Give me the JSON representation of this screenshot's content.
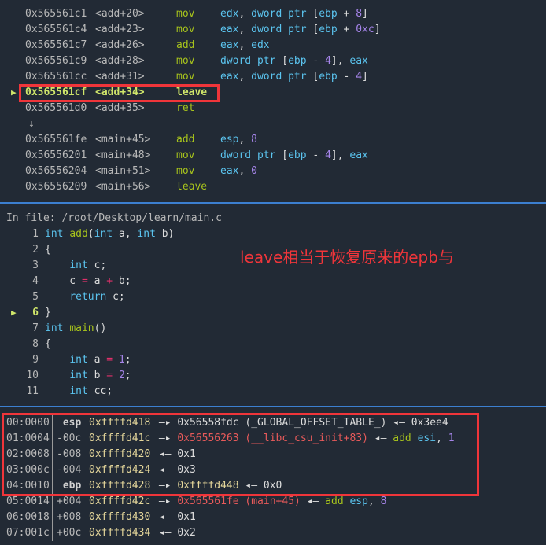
{
  "disasm": [
    {
      "addr": "0x565561c1",
      "sym": "<add+20>",
      "mn": "mov",
      "ops": [
        [
          "edx",
          "blu"
        ],
        [
          ", ",
          "w"
        ],
        [
          "dword ptr ",
          "blu"
        ],
        [
          "[",
          "w"
        ],
        [
          "ebp",
          "blu"
        ],
        [
          " + ",
          "w"
        ],
        [
          "8",
          "pur"
        ],
        [
          "]",
          "w"
        ]
      ]
    },
    {
      "addr": "0x565561c4",
      "sym": "<add+23>",
      "mn": "mov",
      "ops": [
        [
          "eax",
          "blu"
        ],
        [
          ", ",
          "w"
        ],
        [
          "dword ptr ",
          "blu"
        ],
        [
          "[",
          "w"
        ],
        [
          "ebp",
          "blu"
        ],
        [
          " + ",
          "w"
        ],
        [
          "0xc",
          "pur"
        ],
        [
          "]",
          "w"
        ]
      ]
    },
    {
      "addr": "0x565561c7",
      "sym": "<add+26>",
      "mn": "add",
      "ops": [
        [
          "eax",
          "blu"
        ],
        [
          ", ",
          "w"
        ],
        [
          "edx",
          "blu"
        ]
      ]
    },
    {
      "addr": "0x565561c9",
      "sym": "<add+28>",
      "mn": "mov",
      "ops": [
        [
          "dword ptr ",
          "blu"
        ],
        [
          "[",
          "w"
        ],
        [
          "ebp",
          "blu"
        ],
        [
          " - ",
          "w"
        ],
        [
          "4",
          "pur"
        ],
        [
          "], ",
          "w"
        ],
        [
          "eax",
          "blu"
        ]
      ]
    },
    {
      "addr": "0x565561cc",
      "sym": "<add+31>",
      "mn": "mov",
      "ops": [
        [
          "eax",
          "blu"
        ],
        [
          ", ",
          "w"
        ],
        [
          "dword ptr ",
          "blu"
        ],
        [
          "[",
          "w"
        ],
        [
          "ebp",
          "blu"
        ],
        [
          " - ",
          "w"
        ],
        [
          "4",
          "pur"
        ],
        [
          "]",
          "w"
        ]
      ]
    },
    {
      "addr": "0x565561cf",
      "sym": "<add+34>",
      "mn": "leave",
      "ops": [],
      "current": true
    },
    {
      "addr": "0x565561d0",
      "sym": "<add+35>",
      "mn": "ret",
      "ops": []
    },
    {
      "jump": "↓"
    },
    {
      "addr": "0x565561fe",
      "sym": "<main+45>",
      "mn": "add",
      "ops": [
        [
          "esp",
          "blu"
        ],
        [
          ", ",
          "w"
        ],
        [
          "8",
          "pur"
        ]
      ]
    },
    {
      "addr": "0x56556201",
      "sym": "<main+48>",
      "mn": "mov",
      "ops": [
        [
          "dword ptr ",
          "blu"
        ],
        [
          "[",
          "w"
        ],
        [
          "ebp",
          "blu"
        ],
        [
          " - ",
          "w"
        ],
        [
          "4",
          "pur"
        ],
        [
          "], ",
          "w"
        ],
        [
          "eax",
          "blu"
        ]
      ]
    },
    {
      "addr": "0x56556204",
      "sym": "<main+51>",
      "mn": "mov",
      "ops": [
        [
          "eax",
          "blu"
        ],
        [
          ", ",
          "w"
        ],
        [
          "0",
          "pur"
        ]
      ]
    },
    {
      "addr": "0x56556209",
      "sym": "<main+56>",
      "mn": "leave",
      "ops": []
    }
  ],
  "current_marker": "▶",
  "source": {
    "file_label": "In file: /root/Desktop/learn/main.c",
    "lines": [
      {
        "n": "1",
        "code": [
          [
            "int ",
            "blu"
          ],
          [
            "add",
            "grn"
          ],
          [
            "(",
            "w"
          ],
          [
            "int ",
            "blu"
          ],
          [
            "a, ",
            "w"
          ],
          [
            "int ",
            "blu"
          ],
          [
            "b)",
            "w"
          ]
        ]
      },
      {
        "n": "2",
        "code": [
          [
            "{",
            "w"
          ]
        ]
      },
      {
        "n": "3",
        "code": [
          [
            "    ",
            "w"
          ],
          [
            "int ",
            "blu"
          ],
          [
            "c;",
            "w"
          ]
        ]
      },
      {
        "n": "4",
        "code": [
          [
            "    c ",
            "w"
          ],
          [
            "=",
            "pink"
          ],
          [
            " a ",
            "w"
          ],
          [
            "+",
            "pink"
          ],
          [
            " b;",
            "w"
          ]
        ]
      },
      {
        "n": "5",
        "code": [
          [
            "    ",
            "w"
          ],
          [
            "return ",
            "blu"
          ],
          [
            "c;",
            "w"
          ]
        ]
      },
      {
        "n": "6",
        "code": [
          [
            "}",
            "w"
          ]
        ],
        "current": true
      },
      {
        "n": "7",
        "code": [
          [
            "int ",
            "blu"
          ],
          [
            "main",
            "grn"
          ],
          [
            "()",
            "w"
          ]
        ]
      },
      {
        "n": "8",
        "code": [
          [
            "{",
            "w"
          ]
        ]
      },
      {
        "n": "9",
        "code": [
          [
            "    ",
            "w"
          ],
          [
            "int ",
            "blu"
          ],
          [
            "a ",
            "w"
          ],
          [
            "=",
            "pink"
          ],
          [
            " ",
            "w"
          ],
          [
            "1",
            "pur"
          ],
          [
            ";",
            "w"
          ]
        ]
      },
      {
        "n": "10",
        "code": [
          [
            "    ",
            "w"
          ],
          [
            "int ",
            "blu"
          ],
          [
            "b ",
            "w"
          ],
          [
            "=",
            "pink"
          ],
          [
            " ",
            "w"
          ],
          [
            "2",
            "pur"
          ],
          [
            ";",
            "w"
          ]
        ]
      },
      {
        "n": "11",
        "code": [
          [
            "    ",
            "w"
          ],
          [
            "int ",
            "blu"
          ],
          [
            "cc;",
            "w"
          ]
        ]
      }
    ]
  },
  "annotation": "leave相当于恢复原来的epb与",
  "stack": [
    {
      "idx": "00:0000",
      "off": " esp",
      "reg": true,
      "addr": "0xffffd418",
      "rest": [
        [
          " —▸ ",
          "w"
        ],
        [
          "0x56558fdc (_GLOBAL_OFFSET_TABLE_)",
          "w"
        ],
        [
          " ◂— ",
          "w"
        ],
        [
          "0x3ee4",
          "w"
        ]
      ]
    },
    {
      "idx": "01:0004",
      "off": "-00c",
      "addr": "0xffffd41c",
      "rest": [
        [
          " —▸ ",
          "w"
        ],
        [
          "0x56556263 (__libc_csu_init+83)",
          "red"
        ],
        [
          " ◂— ",
          "w"
        ],
        [
          "add ",
          "grn"
        ],
        [
          "esi",
          "blu"
        ],
        [
          ", ",
          "w"
        ],
        [
          "1",
          "pur"
        ]
      ]
    },
    {
      "idx": "02:0008",
      "off": "-008",
      "addr": "0xffffd420",
      "rest": [
        [
          " ◂— ",
          "w"
        ],
        [
          "0x1",
          "w"
        ]
      ]
    },
    {
      "idx": "03:000c",
      "off": "-004",
      "addr": "0xffffd424",
      "rest": [
        [
          " ◂— ",
          "w"
        ],
        [
          "0x3",
          "w"
        ]
      ]
    },
    {
      "idx": "04:0010",
      "off": " ebp",
      "reg": true,
      "addr": "0xffffd428",
      "rest": [
        [
          " —▸ ",
          "w"
        ],
        [
          "0xffffd448",
          "yel"
        ],
        [
          " ◂— ",
          "w"
        ],
        [
          "0x0",
          "w"
        ]
      ]
    },
    {
      "idx": "05:0014",
      "off": "+004",
      "addr": "0xffffd42c",
      "rest": [
        [
          " —▸ ",
          "w"
        ],
        [
          "0x565561fe (main+45)",
          "red"
        ],
        [
          " ◂— ",
          "w"
        ],
        [
          "add ",
          "grn"
        ],
        [
          "esp",
          "blu"
        ],
        [
          ", ",
          "w"
        ],
        [
          "8",
          "pur"
        ]
      ]
    },
    {
      "idx": "06:0018",
      "off": "+008",
      "addr": "0xffffd430",
      "rest": [
        [
          " ◂— ",
          "w"
        ],
        [
          "0x1",
          "w"
        ]
      ]
    },
    {
      "idx": "07:001c",
      "off": "+00c",
      "addr": "0xffffd434",
      "rest": [
        [
          " ◂— ",
          "w"
        ],
        [
          "0x2",
          "w"
        ]
      ]
    }
  ],
  "colors": {
    "background": "#222a35",
    "highlight_box": "#f0353a",
    "separator": "#3c7fd0",
    "mnemonic": "#a8c41c",
    "register": "#5bc4ef",
    "number": "#a685ea",
    "stack_address": "#e5d79b",
    "code_pointer": "#e85a5a"
  }
}
